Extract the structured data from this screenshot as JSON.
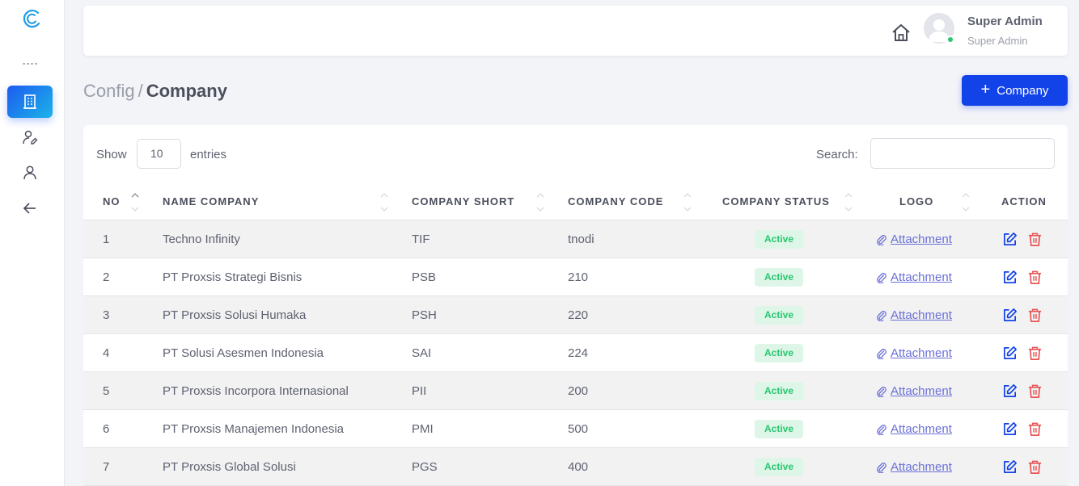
{
  "sidebar": {
    "items": [
      {
        "name": "company-nav-icon",
        "active": true
      },
      {
        "name": "user-settings-nav-icon",
        "active": false
      },
      {
        "name": "user-nav-icon",
        "active": false
      },
      {
        "name": "back-nav-icon",
        "active": false
      }
    ]
  },
  "header": {
    "user_name": "Super Admin",
    "user_role": "Super Admin"
  },
  "breadcrumb": {
    "parent": "Config",
    "separator": "/",
    "current": "Company"
  },
  "add_button": {
    "label": "Company"
  },
  "table_controls": {
    "show_label": "Show",
    "entries_value": "10",
    "entries_label": "entries",
    "search_label": "Search:",
    "search_value": ""
  },
  "table": {
    "columns": [
      "NO",
      "NAME COMPANY",
      "COMPANY SHORT",
      "COMPANY CODE",
      "COMPANY STATUS",
      "LOGO",
      "ACTION"
    ],
    "rows": [
      {
        "no": "1",
        "name": "Techno Infinity",
        "short": "TIF",
        "code": "tnodi",
        "status": "Active",
        "logo": "Attachment"
      },
      {
        "no": "2",
        "name": "PT Proxsis Strategi Bisnis",
        "short": "PSB",
        "code": "210",
        "status": "Active",
        "logo": "Attachment"
      },
      {
        "no": "3",
        "name": "PT Proxsis Solusi Humaka",
        "short": "PSH",
        "code": "220",
        "status": "Active",
        "logo": "Attachment"
      },
      {
        "no": "4",
        "name": "PT Solusi Asesmen Indonesia",
        "short": "SAI",
        "code": "224",
        "status": "Active",
        "logo": "Attachment"
      },
      {
        "no": "5",
        "name": "PT Proxsis Incorpora Internasional",
        "short": "PII",
        "code": "200",
        "status": "Active",
        "logo": "Attachment"
      },
      {
        "no": "6",
        "name": "PT Proxsis Manajemen Indonesia",
        "short": "PMI",
        "code": "500",
        "status": "Active",
        "logo": "Attachment"
      },
      {
        "no": "7",
        "name": "PT Proxsis Global Solusi",
        "short": "PGS",
        "code": "400",
        "status": "Active",
        "logo": "Attachment"
      }
    ]
  },
  "colors": {
    "primary": "#1243e8",
    "active_badge_bg": "#ddf6e8",
    "active_badge_text": "#28c76f",
    "edit_icon": "#1243e8",
    "delete_icon": "#ea5455",
    "link": "#6a6fd6"
  }
}
